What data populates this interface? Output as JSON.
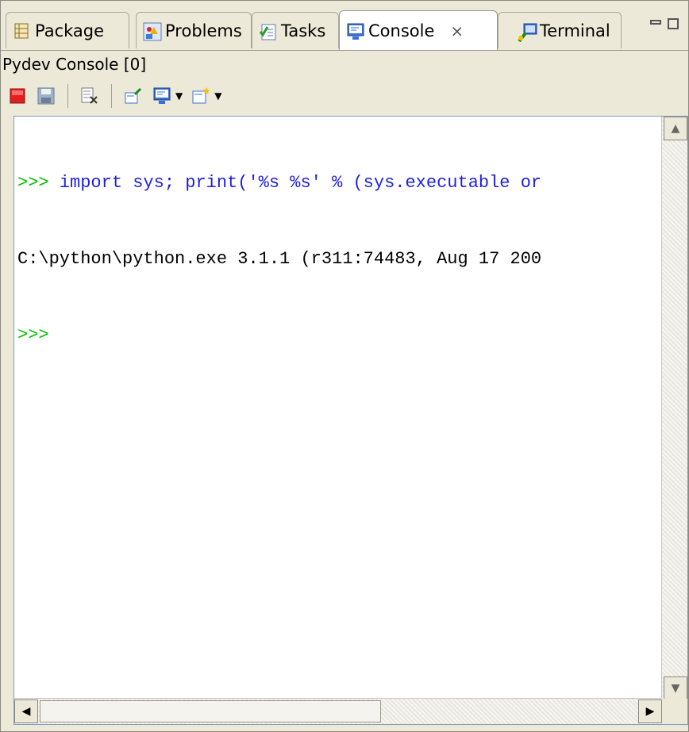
{
  "tabs": [
    {
      "label": "Package",
      "icon": "package-icon"
    },
    {
      "label": "Problems",
      "icon": "problems-icon"
    },
    {
      "label": "Tasks",
      "icon": "tasks-icon"
    },
    {
      "label": "Console",
      "icon": "console-icon",
      "active": true
    },
    {
      "label": "Terminal",
      "icon": "terminal-icon"
    }
  ],
  "console_title": "Pydev Console [0]",
  "toolbar": {
    "icons": [
      "terminate-icon",
      "save-icon",
      "clear-console-icon",
      "pin-console-icon",
      "display-console-icon",
      "new-console-icon"
    ]
  },
  "console": {
    "lines": [
      {
        "prompt": ">>>",
        "text": " import sys; print('%s %s' % (sys.executable or"
      },
      {
        "prompt": "",
        "text": "C:\\python\\python.exe 3.1.1 (r311:74483, Aug 17 200"
      },
      {
        "prompt": ">>>",
        "text": ""
      }
    ]
  },
  "colors": {
    "prompt": "#00c000",
    "input": "#1f1fe0",
    "output": "#000000"
  }
}
